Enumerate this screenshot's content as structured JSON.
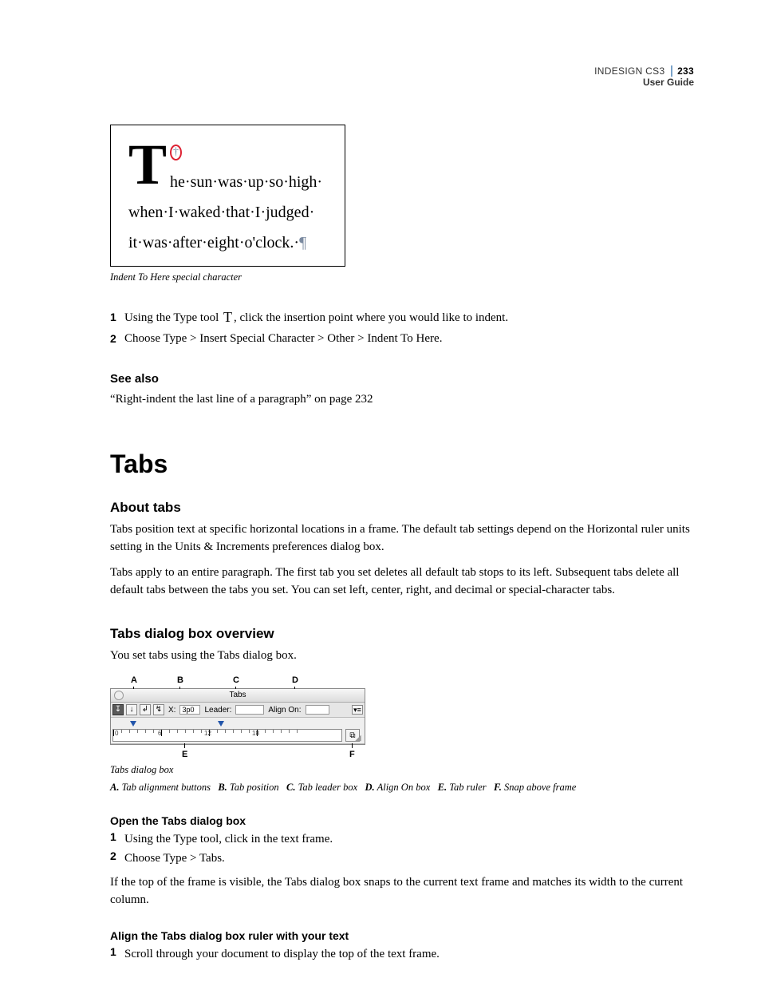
{
  "header": {
    "product": "INDESIGN CS3",
    "guide": "User Guide",
    "page_number": "233"
  },
  "figure1": {
    "dropcap_letter": "T",
    "line1_rest": "he·sun·was·up·so·high·",
    "line2": "when·I·waked·that·I·judged·",
    "line3": "it·was·after·eight·o'clock.·",
    "pilcrow": "¶",
    "caption": "Indent To Here special character"
  },
  "steps_top": [
    {
      "num": "1",
      "before": "Using the Type tool ",
      "after": ", click the insertion point where you would like to indent."
    },
    {
      "num": "2",
      "before": "Choose Type > Insert Special Character > Other > Indent To Here.",
      "after": ""
    }
  ],
  "see_also": {
    "heading": "See also",
    "link": "“Right-indent the last line of a paragraph” on page 232"
  },
  "h1": "Tabs",
  "about": {
    "heading": "About tabs",
    "p1": "Tabs position text at specific horizontal locations in a frame. The default tab settings depend on the Horizontal ruler units setting in the Units & Increments preferences dialog box.",
    "p2": "Tabs apply to an entire paragraph. The first tab you set deletes all default tab stops to its left. Subsequent tabs delete all default tabs between the tabs you set. You can set left, center, right, and decimal or special-character tabs."
  },
  "overview": {
    "heading": "Tabs dialog box overview",
    "p1": "You set tabs using the Tabs dialog box."
  },
  "dialog": {
    "callouts_top": {
      "A": "A",
      "B": "B",
      "C": "C",
      "D": "D"
    },
    "callouts_bottom": {
      "E": "E",
      "F": "F"
    },
    "title": "Tabs",
    "x_label": "X:",
    "x_value": "3p0",
    "leader_label": "Leader:",
    "leader_value": "",
    "align_label": "Align On:",
    "align_value": "",
    "ruler_numbers": [
      "0",
      "6",
      "12",
      "18"
    ],
    "caption": "Tabs dialog box",
    "legend_items": [
      {
        "k": "A.",
        "v": "Tab alignment buttons"
      },
      {
        "k": "B.",
        "v": "Tab position"
      },
      {
        "k": "C.",
        "v": "Tab leader box"
      },
      {
        "k": "D.",
        "v": "Align On box"
      },
      {
        "k": "E.",
        "v": "Tab ruler"
      },
      {
        "k": "F.",
        "v": "Snap above frame"
      }
    ]
  },
  "open_dialog": {
    "heading": "Open the Tabs dialog box",
    "steps": [
      {
        "num": "1",
        "txt": "Using the Type tool, click in the text frame."
      },
      {
        "num": "2",
        "txt": "Choose Type > Tabs."
      }
    ],
    "note": "If the top of the frame is visible, the Tabs dialog box snaps to the current text frame and matches its width to the current column."
  },
  "align_ruler": {
    "heading": "Align the Tabs dialog box ruler with your text",
    "steps": [
      {
        "num": "1",
        "txt": "Scroll through your document to display the top of the text frame."
      }
    ]
  }
}
